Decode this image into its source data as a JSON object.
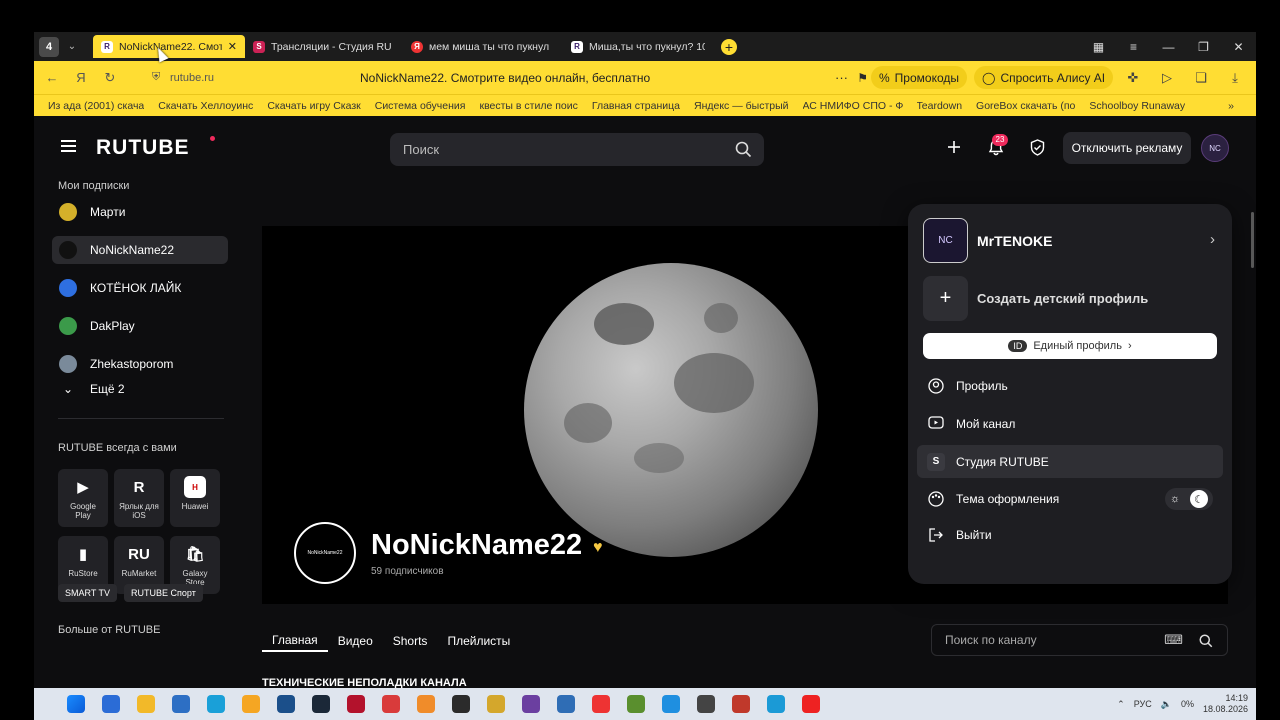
{
  "browser": {
    "tab_count": "4",
    "tabs": [
      {
        "title": "NoNickName22. Смотр",
        "favicon": "R",
        "color": "#3a1f6b",
        "active": true
      },
      {
        "title": "Трансляции - Студия RU",
        "favicon": "S",
        "color": "#cc2255",
        "active": false
      },
      {
        "title": "мем миша ты что пукнул",
        "favicon": "Я",
        "color": "#e33",
        "active": false
      },
      {
        "title": "Миша,ты что пукнул? 10",
        "favicon": "R",
        "color": "#3a1f6b",
        "active": false
      }
    ],
    "url_domain": "rutube.ru",
    "page_title": "NoNickName22. Смотрите видео онлайн, бесплатно",
    "promo_label": "Промокоды",
    "alice_label": "Спросить Алису AI",
    "bookmarks": [
      "Из ада (2001) скача",
      "Скачать Хеллоуинс",
      "Скачать игру Сказк",
      "Система обучения",
      "квесты в стиле поис",
      "Главная страница",
      "Яндекс — быстрый",
      "АС НМИФО СПО - Ф",
      "Teardown",
      "GoreBox скачать (по",
      "Schoolboy Runaway"
    ]
  },
  "header": {
    "logo": "RUTUBE",
    "search_placeholder": "Поиск",
    "notifications_count": "23",
    "no_ads_label": "Отключить рекламу",
    "avatar_text": "NC"
  },
  "sidebar": {
    "subs_title": "Мои подписки",
    "subscriptions": [
      {
        "name": "Марти",
        "color": "#d4b02a"
      },
      {
        "name": "NoNickName22",
        "color": "#111"
      },
      {
        "name": "КОТЁНОК ЛАЙК",
        "color": "#2e6fe0"
      },
      {
        "name": "DakPlay",
        "color": "#3b9a4a"
      },
      {
        "name": "Zhekastoporom",
        "color": "#7a8a9a"
      }
    ],
    "more_label": "Ещё 2",
    "apps_title": "RUTUBE всегда с вами",
    "apps": [
      {
        "label": "Google Play",
        "glyph": "▶"
      },
      {
        "label": "Ярлык для iOS",
        "glyph": "R"
      },
      {
        "label": "Huawei",
        "glyph": "H"
      },
      {
        "label": "RuStore",
        "glyph": "▮"
      },
      {
        "label": "RuMarket",
        "glyph": "RU"
      },
      {
        "label": "Galaxy Store",
        "glyph": "🛍"
      }
    ],
    "more_title": "Больше от RUTUBE",
    "chips": [
      "SMART TV",
      "RUTUBE Спорт"
    ]
  },
  "channel": {
    "name": "NoNickName22",
    "subscribers": "59 подписчиков",
    "avatar_text": "NoNickName22",
    "tabs": [
      "Главная",
      "Видео",
      "Shorts",
      "Плейлисты"
    ],
    "search_placeholder": "Поиск по каналу",
    "section_title": "ТЕХНИЧЕСКИЕ НЕПОЛАДКИ КАНАЛА",
    "section_sub": "..."
  },
  "menu": {
    "user_name": "MrTENOKE",
    "kid_profile": "Создать детский профиль",
    "unified_id_badge": "ID",
    "unified_profile": "Единый профиль",
    "items": [
      {
        "label": "Профиль",
        "icon": "user-circle-icon"
      },
      {
        "label": "Мой канал",
        "icon": "play-square-icon"
      },
      {
        "label": "Студия RUTUBE",
        "icon": "studio-s-icon"
      },
      {
        "label": "Тема оформления",
        "icon": "palette-icon"
      },
      {
        "label": "Выйти",
        "icon": "logout-icon"
      }
    ]
  },
  "taskbar": {
    "lang": "РУС",
    "battery": "0%",
    "time": "14:19",
    "date": "18.08.2026"
  },
  "colors": {
    "accent": "#ffdd33",
    "rutube_pink": "#ee2a5c",
    "page_bg": "#0d0d0f"
  }
}
